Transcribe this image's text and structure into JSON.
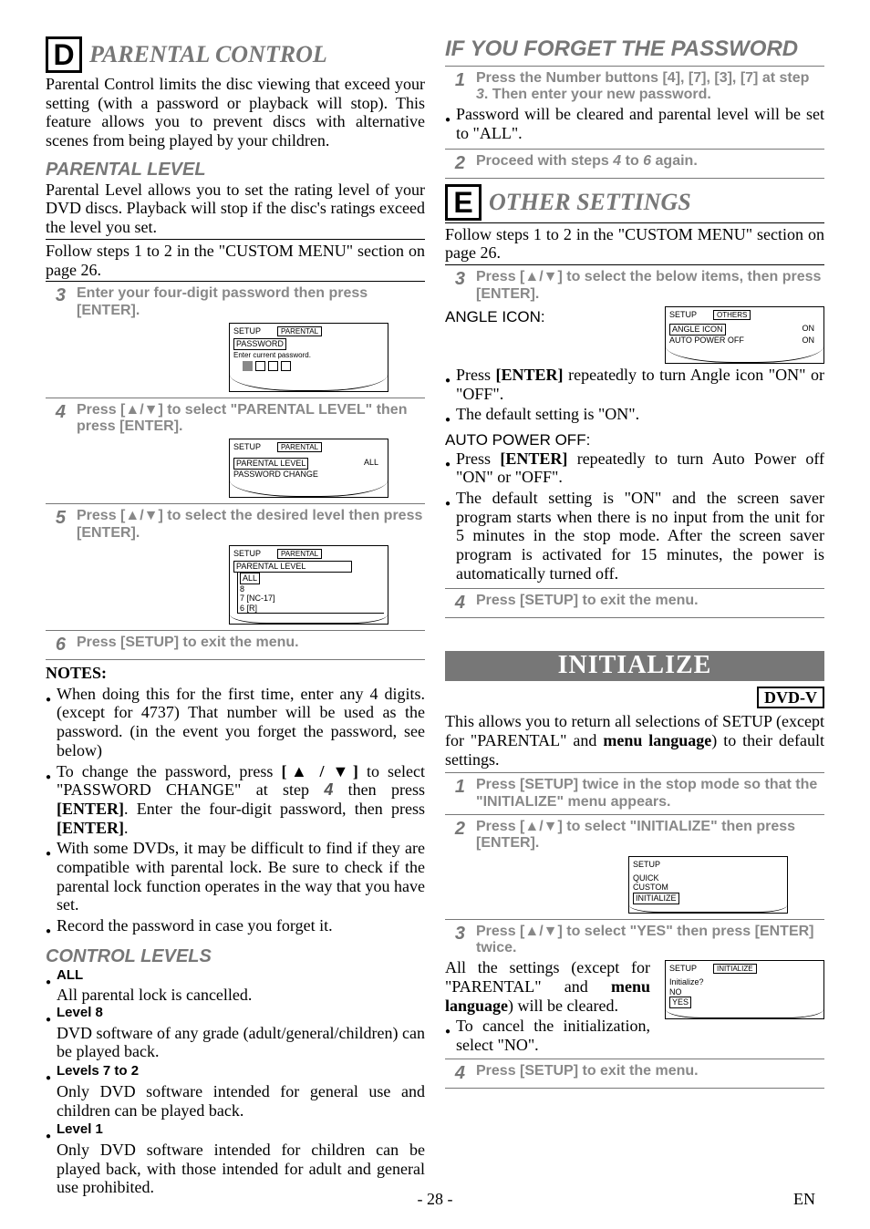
{
  "left": {
    "letter": "D",
    "title": "PARENTAL CONTROL",
    "intro": "Parental Control limits the disc viewing that exceed your setting (with a password or playback will stop). This feature allows you to prevent discs with alternative scenes from being played by your children.",
    "pl_head": "PARENTAL LEVEL",
    "pl_intro": "Parental Level allows you to set the rating level of your DVD discs. Playback will stop if the disc's ratings exceed the level you set.",
    "follow": "Follow steps 1 to 2 in the \"CUSTOM MENU\" section on page 26.",
    "step3": "Enter your four-digit password then press [ENTER].",
    "scr1": {
      "tab1": "SETUP",
      "tab2": "PARENTAL",
      "row1": "PASSWORD",
      "row2": "Enter current password."
    },
    "step4": "Press [▲/▼] to select \"PARENTAL LEVEL\" then press [ENTER].",
    "scr2": {
      "tab1": "SETUP",
      "tab2": "PARENTAL",
      "row1": "PARENTAL LEVEL",
      "val1": "ALL",
      "row2": "PASSWORD CHANGE"
    },
    "step5": "Press [▲/▼] to select the desired level then press [ENTER].",
    "scr3": {
      "tab1": "SETUP",
      "tab2": "PARENTAL",
      "head": "PARENTAL LEVEL",
      "o1": "ALL",
      "o2": "8",
      "o3": "7 [NC-17]",
      "o4": "6 [R]"
    },
    "step6": "Press [SETUP] to exit the menu.",
    "notes_h": "NOTES:",
    "n1": "When doing this for the first time, enter any 4 digits. (except for 4737) That number will be used as the password. (in the event you forget the password, see below)",
    "n2a": "To change the password, press ",
    "n2b": " to select \"PASSWORD CHANGE\" at step ",
    "n2c": " then press ",
    "n2d": ". Enter the four-digit password, then press ",
    "n2e": ".",
    "n2step": "4",
    "n2btn": "[▲ / ▼]",
    "enter": "[ENTER]",
    "n3": "With some DVDs, it may be difficult to find if they are compatible with parental lock. Be sure to check if the parental lock function operates in the way that you have set.",
    "n4": "Record the password in case you forget it.",
    "cl_head": "CONTROL LEVELS",
    "cl": [
      {
        "h": "ALL",
        "t": "All parental lock is cancelled."
      },
      {
        "h": "Level 8",
        "t": "DVD software of any grade (adult/general/children) can be played back."
      },
      {
        "h": "Levels 7 to 2",
        "t": "Only DVD software intended for general use and children can be played back."
      },
      {
        "h": "Level 1",
        "t": "Only DVD software intended for children can be played back, with those intended for adult and general use prohibited."
      }
    ]
  },
  "right": {
    "forget_h": "IF YOU FORGET THE PASSWORD",
    "f_step1a": "Press the Number buttons [4], [7], [3], [7] at step ",
    "f_step1b": ". Then enter your new password.",
    "f_step1s": "3",
    "f_b1": "Password will be cleared and parental level will be set to \"ALL\".",
    "f_step2a": "Proceed with steps ",
    "f_step2b": " to ",
    "f_step2c": " again.",
    "f_s4": "4",
    "f_s6": "6",
    "letter": "E",
    "title": "OTHER SETTINGS",
    "follow": "Follow steps 1 to 2 in the \"CUSTOM MENU\" section on page 26.",
    "step3": "Press [▲/▼] to select the below items, then press [ENTER].",
    "scrE": {
      "tab1": "SETUP",
      "tab2": "OTHERS",
      "r1": "ANGLE ICON",
      "v1": "ON",
      "r2": "AUTO POWER OFF",
      "v2": "ON"
    },
    "ai_h": "ANGLE ICON:",
    "ai_b1a": "Press ",
    "ai_b1b": " repeatedly to turn Angle icon \"ON\" or \"OFF\".",
    "ai_b2": "The default setting is \"ON\".",
    "apo_h": "AUTO POWER OFF:",
    "apo_b1a": "Press ",
    "apo_b1b": " repeatedly to turn Auto Power off \"ON\" or \"OFF\".",
    "apo_b2": "The default setting is \"ON\" and the screen saver program starts when there is no input from the unit for 5 minutes in the stop mode. After the screen saver program is activated for 15 minutes, the power is automatically turned off.",
    "step4": "Press [SETUP] to exit the menu.",
    "init_banner": "INITIALIZE",
    "tag": "DVD-V",
    "init_intro1": "This allows you to return all selections of SETUP (except for \"PARENTAL\" and ",
    "init_intro2": ") to their default settings.",
    "menulang": "menu language",
    "i_step1": "Press [SETUP] twice in the stop mode so that the \"INITIALIZE\" menu appears.",
    "i_step2": "Press [▲/▼] to select \"INITIALIZE\" then press [ENTER].",
    "scrI1": {
      "tab1": "SETUP",
      "o1": "QUICK",
      "o2": "CUSTOM",
      "o3": "INITIALIZE"
    },
    "i_step3": "Press [▲/▼] to select \"YES\" then press [ENTER] twice.",
    "i_res1": "All the settings (except for \"PARENTAL\" and ",
    "i_res2": ") will be cleared.",
    "i_b1": "To cancel the initialization, select \"NO\".",
    "scrI2": {
      "tab1": "SETUP",
      "tab2": "INITIALIZE",
      "q": "Initialize?",
      "o1": "NO",
      "o2": "YES"
    },
    "i_step4": "Press [SETUP] to exit the menu."
  },
  "footer": "- 28 -",
  "footer_r": "EN"
}
